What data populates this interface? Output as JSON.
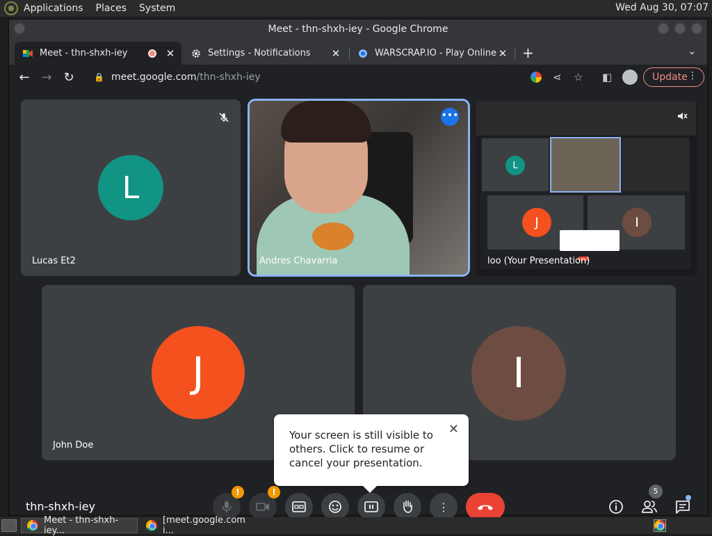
{
  "desktop": {
    "menus": [
      "Applications",
      "Places",
      "System"
    ],
    "clock": "Wed Aug 30, 07:07"
  },
  "window": {
    "title": "Meet - thn-shxh-iey - Google Chrome"
  },
  "tabs": [
    {
      "title": "Meet - thn-shxh-iey",
      "active": true
    },
    {
      "title": "Settings - Notifications",
      "active": false
    },
    {
      "title": "WARSCRAP.IO - Play Online",
      "active": false
    }
  ],
  "address": {
    "host": "meet.google.com",
    "path": "/thn-shxh-iey"
  },
  "toolbar": {
    "update_label": "Update"
  },
  "participants": [
    {
      "name": "Lucas Et2",
      "initial": "L",
      "color": "#129484"
    },
    {
      "name": "Andres Chavarria",
      "initial": "",
      "color": ""
    },
    {
      "name": "loo (Your Presentation)",
      "initial": "",
      "color": ""
    },
    {
      "name": "John Doe",
      "initial": "J",
      "color": "#f4511e"
    },
    {
      "name": "",
      "initial": "I",
      "color": "#6d4c41"
    }
  ],
  "tooltip": {
    "text": "Your screen is still visible to others. Click to resume or cancel your presentation."
  },
  "meeting": {
    "code": "thn-shxh-iey",
    "people_count": "5"
  },
  "taskbar": [
    {
      "label": "Meet - thn-shxh-iey..."
    },
    {
      "label": "[meet.google.com i..."
    }
  ]
}
